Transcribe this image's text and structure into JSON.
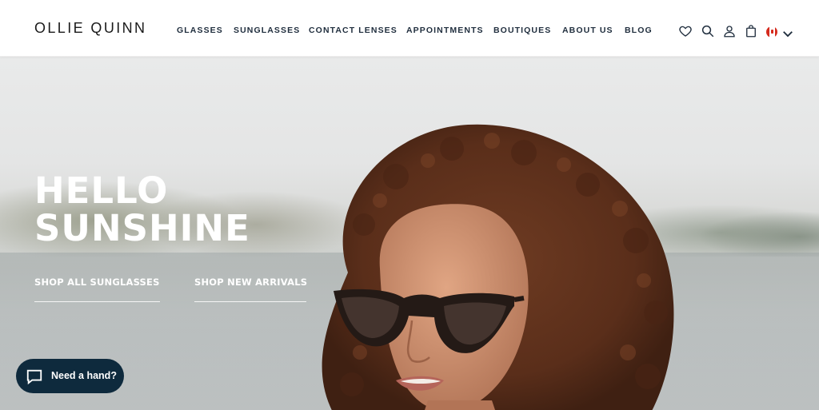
{
  "header": {
    "logo": "OLLIE QUINN",
    "nav": [
      {
        "label": "GLASSES"
      },
      {
        "label": "SUNGLASSES"
      },
      {
        "label": "CONTACT LENSES"
      },
      {
        "label": "APPOINTMENTS"
      },
      {
        "label": "BOUTIQUES"
      },
      {
        "label": "ABOUT US"
      },
      {
        "label": "BLOG"
      }
    ],
    "icons": [
      "heart-icon",
      "search-icon",
      "account-icon",
      "bag-icon",
      "canada-flag-icon",
      "chevron-down-icon"
    ]
  },
  "hero": {
    "title_line1": "HELLO",
    "title_line2": "SUNSHINE",
    "cta_primary": "SHOP ALL SUNGLASSES",
    "cta_secondary": "SHOP NEW ARRIVALS"
  },
  "chat": {
    "label": "Need a hand?"
  },
  "colors": {
    "nav_text": "#1f2d3d",
    "chat_bg": "#0e2a3d",
    "hero_text": "#ffffff"
  }
}
